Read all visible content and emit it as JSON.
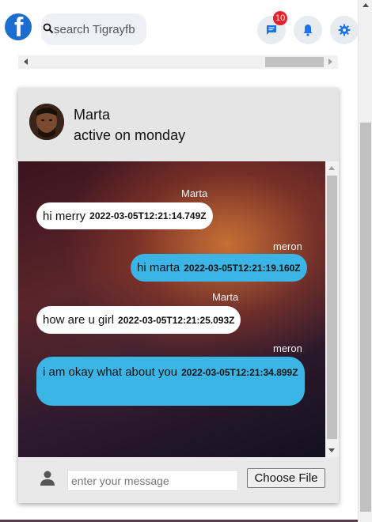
{
  "topbar": {
    "search_placeholder": "search Tigrayfb",
    "messages_badge": "10",
    "brand_color": "#1c6dd0",
    "icon_color": "#1a73e8"
  },
  "chat": {
    "contact_name": "Marta",
    "contact_status": "active on monday",
    "messages": [
      {
        "sender": "Marta",
        "text": "hi merry",
        "timestamp": "2022-03-05T12:21:14.749Z",
        "direction": "incoming"
      },
      {
        "sender": "meron",
        "text": "hi marta",
        "timestamp": "2022-03-05T12:21:19.160Z",
        "direction": "outgoing"
      },
      {
        "sender": "Marta",
        "text": "how are u girl",
        "timestamp": "2022-03-05T12:21:25.093Z",
        "direction": "incoming"
      },
      {
        "sender": "meron",
        "text": "i am okay what about you",
        "timestamp": "2022-03-05T12:21:34.899Z",
        "direction": "outgoing"
      }
    ],
    "colors": {
      "incoming_bubble": "#ffffff",
      "outgoing_bubble": "#3ab5e6"
    }
  },
  "composer": {
    "input_placeholder": "enter your message",
    "file_button_label": "Choose File"
  }
}
